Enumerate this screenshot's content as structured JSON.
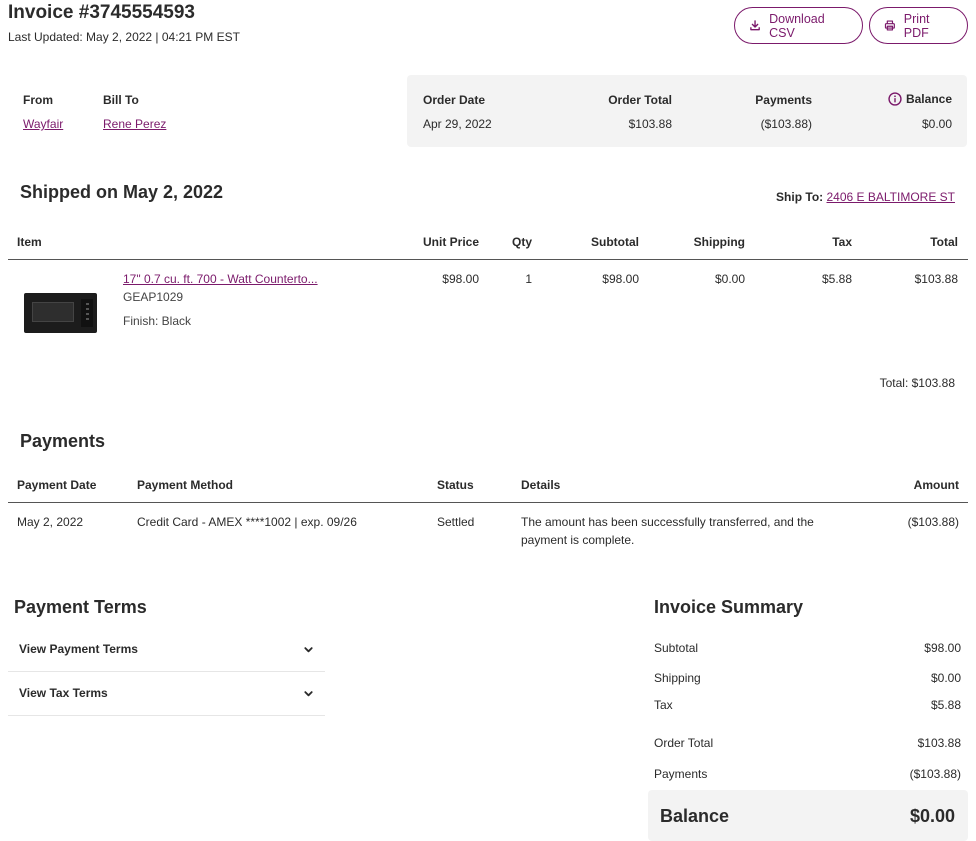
{
  "header": {
    "title": "Invoice #3745554593",
    "last_updated": "Last Updated: May 2, 2022 | 04:21 PM EST",
    "download_csv": "Download CSV",
    "print_pdf": "Print PDF"
  },
  "parties": {
    "from_label": "From",
    "from_value": "Wayfair",
    "bill_to_label": "Bill To",
    "bill_to_value": "Rene Perez"
  },
  "order_summary": {
    "order_date_label": "Order Date",
    "order_date_value": "Apr 29, 2022",
    "order_total_label": "Order Total",
    "order_total_value": "$103.88",
    "payments_label": "Payments",
    "payments_value": "($103.88)",
    "balance_label": "Balance",
    "balance_value": "$0.00"
  },
  "shipment": {
    "title": "Shipped on May 2, 2022",
    "ship_to_label": "Ship To:",
    "ship_to_value": "2406 E BALTIMORE ST",
    "columns": {
      "item": "Item",
      "unit_price": "Unit Price",
      "qty": "Qty",
      "subtotal": "Subtotal",
      "shipping": "Shipping",
      "tax": "Tax",
      "total": "Total"
    },
    "item": {
      "name": "17\" 0.7 cu. ft. 700 - Watt Countertо...",
      "sku": "GEAP1029",
      "finish": "Finish: Black",
      "unit_price": "$98.00",
      "qty": "1",
      "subtotal": "$98.00",
      "shipping": "$0.00",
      "tax": "$5.88",
      "total": "$103.88"
    },
    "grand_total": "Total: $103.88"
  },
  "payments": {
    "title": "Payments",
    "columns": {
      "date": "Payment Date",
      "method": "Payment Method",
      "status": "Status",
      "details": "Details",
      "amount": "Amount"
    },
    "row": {
      "date": "May 2, 2022",
      "method": "Credit Card - AMEX ****1002 | exp. 09/26",
      "status": "Settled",
      "details_line1": "The amount has been successfully transferred, and the",
      "details_line2": "payment is complete.",
      "amount": "($103.88)"
    }
  },
  "payment_terms": {
    "title": "Payment Terms",
    "view_payment_terms": "View Payment Terms",
    "view_tax_terms": "View Tax Terms"
  },
  "invoice_summary": {
    "title": "Invoice Summary",
    "subtotal_label": "Subtotal",
    "subtotal_value": "$98.00",
    "shipping_label": "Shipping",
    "shipping_value": "$0.00",
    "tax_label": "Tax",
    "tax_value": "$5.88",
    "order_total_label": "Order Total",
    "order_total_value": "$103.88",
    "payments_label": "Payments",
    "payments_value": "($103.88)",
    "balance_label": "Balance",
    "balance_value": "$0.00"
  },
  "colors": {
    "accent": "#7b1a6b",
    "panel_bg": "#f3f3f3",
    "text": "#2b2b2b"
  }
}
